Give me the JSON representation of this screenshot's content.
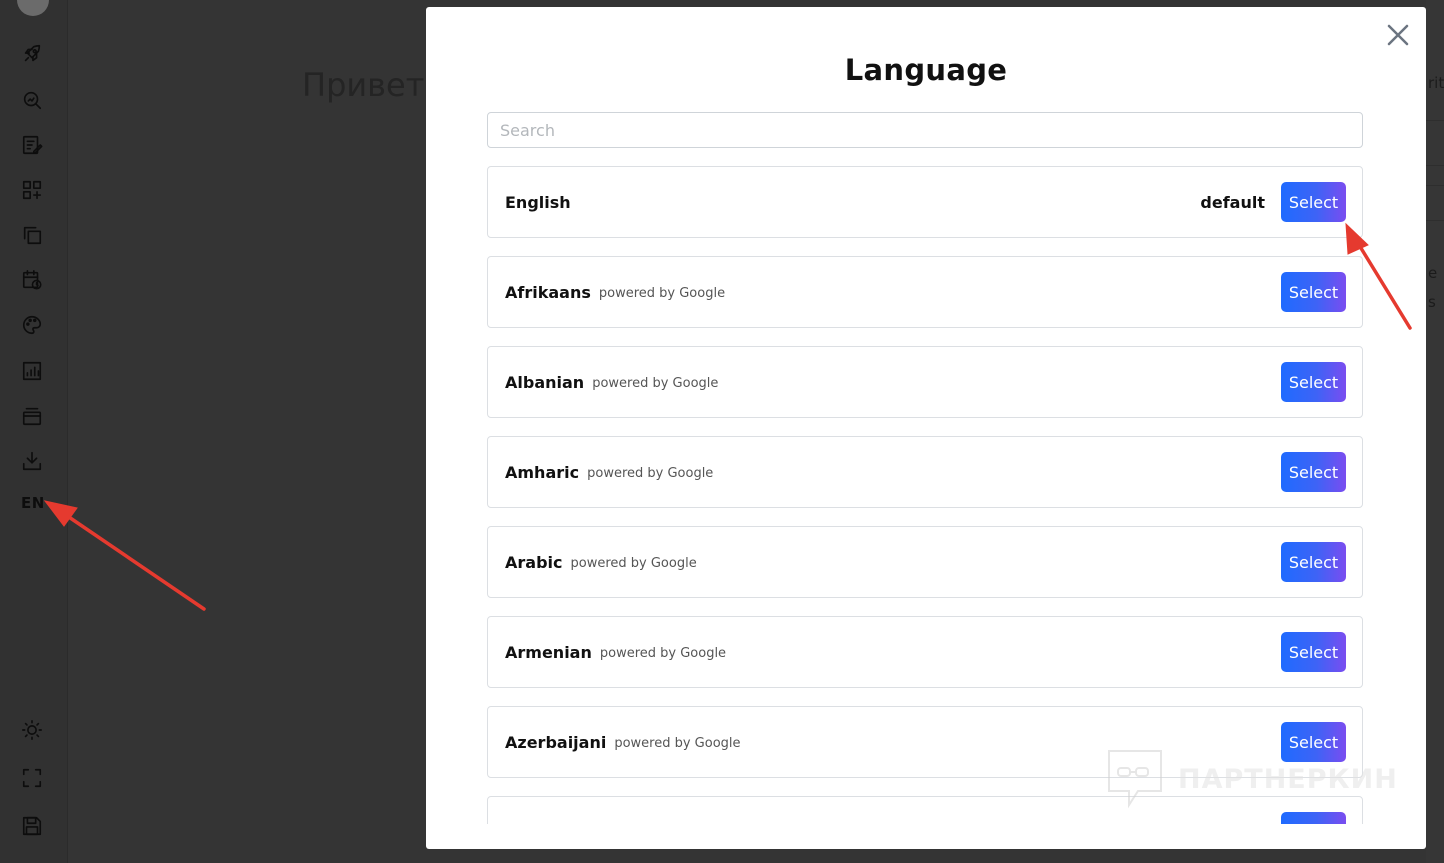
{
  "sidebar": {
    "icons": [
      "rocket-icon",
      "search-analytics-icon",
      "edit-note-icon",
      "apps-add-icon",
      "copy-icon",
      "calendar-clock-icon",
      "palette-icon",
      "bar-chart-icon",
      "archive-icon",
      "download-icon"
    ],
    "language_code": "EN",
    "bottom_icons": [
      "sun-icon",
      "fullscreen-icon",
      "save-icon"
    ]
  },
  "background": {
    "heading_fragment": "Привет",
    "right_fragments": [
      "rit",
      "e",
      "s"
    ]
  },
  "modal": {
    "title": "Language",
    "search": {
      "placeholder": "Search",
      "value": ""
    },
    "select_label": "Select",
    "default_label": "default",
    "powered_label": "powered by Google",
    "languages": [
      {
        "name": "English",
        "default": true
      },
      {
        "name": "Afrikaans",
        "powered": true
      },
      {
        "name": "Albanian",
        "powered": true
      },
      {
        "name": "Amharic",
        "powered": true
      },
      {
        "name": "Arabic",
        "powered": true
      },
      {
        "name": "Armenian",
        "powered": true
      },
      {
        "name": "Azerbaijani",
        "powered": true
      },
      {
        "name": ""
      }
    ]
  },
  "watermark": {
    "text": "ПАРТНЕРКИН"
  },
  "colors": {
    "overlay": "#343434",
    "button_gradient_start": "#1f6bff",
    "button_gradient_end": "#7a4df0",
    "annotation_arrow": "#e53a2f"
  }
}
